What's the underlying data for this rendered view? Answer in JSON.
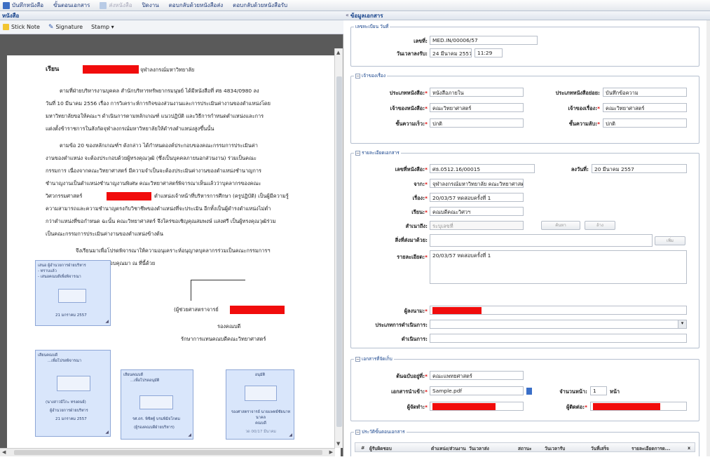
{
  "toolbar": {
    "save_label": "บันทึกหนังสือ",
    "steps_label": "ขั้นตอนเอกสาร",
    "send_label": "ส่งหนังสือ",
    "close_label": "ปิดงาน",
    "reply_send_label": "ตอบกลับด้วยหนังสือส่ง",
    "reply_recv_label": "ตอบกลับด้วยหนังสือรับ"
  },
  "left_panel": {
    "title": "หนังสือ"
  },
  "right_panel": {
    "title": "ข้อมูลเอกสาร"
  },
  "viewer_toolbar": {
    "sticknote_label": "Stick Note",
    "signature_label": "Signature",
    "stamp_label": "Stamp ▾"
  },
  "document": {
    "salutation": "เรียน",
    "recipient": "จุฬาลงกรณ์มหาวิทยาลัย",
    "p1": [
      "ตามที่ฝ่ายบริหารงานบุคคล สำนักบริหารทรัพยากรมนุษย์ ได้มีหนังสือที่ ศธ 4834/0980 ลง",
      "วันที่ 10 มีนาคม 2556 เรื่อง การวิเคราะห์การกิจของส่วนงานและการประเมินค่างานของตำแหน่งโดย",
      "มหาวิทยาลัยขอให้คณะฯ ดำเนินการตามหลักเกณฑ์ แนวปฏิบัติ และวิธีการกำหนดตำแหน่งและการ",
      "แต่งตั้งข้าราชการในสังกัดจุฬาลงกรณ์มหาวิทยาลัยให้ดำรงตำแหน่งสูงขึ้นนั้น"
    ],
    "p2": [
      "ตามข้อ 20 ของหลักเกณฑ์ฯ ดังกล่าว ได้กำหนดองค์ประกอบของคณะกรรมการประเมินค่า",
      "งานของตำแหน่ง จะต้องประกอบด้วยผู้ทรงคุณวุฒิ (ซึ่งเป็นบุคคลภายนอกส่วนงาน) ร่วมเป็นคณะ",
      "กรรมการ เนื่องจากคณะวิทยาศาสตร์ มีความจำเป็นจะต้องประเมินค่างานของตำแหน่งชำนาญการ",
      "ชำนาญงานเป็นตำแหน่งชำนาญงานพิเศษ คณะวิทยาศาสตร์พิจารณาเห็นแล้วว่าบุคลากรของคณะ",
      "วิศวกรรมศาสตร์",
      "ตำแหน่งเจ้าหน้าที่บริหารการศึกษา (ครูปฏิบัติ) เป็นผู้มีความรู้",
      "ความสามารถและความชำนาญตรงกับวิชาชีพของตำแหน่งที่จะประเมิน อีกทั้งเป็นผู้ดำรงตำแหน่งไม่ต่ำ",
      "กว่าตำแหน่งที่ขอกำหนด ฉะนั้น คณะวิทยาศาสตร์ จึงใคร่ขอเชิญคุณสมพงษ์ แสงศรี เป็นผู้ทรงคุณวุฒิร่วม",
      "เป็นคณะกรรมการประเมินค่างานของตำแหน่งข้างต้น"
    ],
    "p3": [
      "จึงเรียนมาเพื่อโปรดพิจารณาให้ความอนุเคราะห์อนุญาตบุคลากรร่วมเป็นคณะกรรมการฯ",
      "ขอขอบคุณมา ณ ที่นี้ด้วย"
    ],
    "signer_prefix": "(ผู้ช่วยศาสตราจารย์",
    "signer_title1": "รองคณบดี",
    "signer_title2": "รักษาการแทนคณบดีคณะวิทยาศาสตร์"
  },
  "notes": {
    "n1_l1": "เสนอ ผู้อำนวยการฝ่ายบริหาร",
    "n1_l2": "- ทราบแล้ว",
    "n1_l3": "- เสนอคณบดีเพื่อพิจารณา",
    "n1_date": "21 มกราคม 2557",
    "n2_l1": "เสียนคณบดี",
    "n2_l2": "...เพื่อโปรดพิจารณา",
    "n2_name": "(นางสาวมีโกะ ทรงดนย์)",
    "n2_title": "ผู้อำนวยการฝ่ายบริหาร",
    "n2_date": "21 มกราคม 2557",
    "n3_l1": "เสียนคณบดี",
    "n3_l2": "...เพื่อโปรดอนุมัติ",
    "n3_name": "รศ.ดร. พิชิตฐ์ บรมพิมิจโกตม",
    "n3_title": "(ผู้รองคณบดีฝ่ายบริหาร)",
    "n4_l1": "อนุมัติ",
    "n4_name": "รองศาสตราจารย์ นายแพทย์ชัยนาท นาคล",
    "n4_title": "คณบดี",
    "n4_date": "วด 00/17 มีนาคม"
  },
  "fields": {
    "doc_no_label": "เลขที่:",
    "doc_no": "MED.IN/00006/57",
    "datetime_label": "วันเวลาลงรับ:",
    "date": "24 มีนาคม 2557",
    "time": "11:29",
    "booknum_section": "เลขทะเบียน วันที่",
    "owner_section": "เจ้าของเรื่อง",
    "doc_type_label": "ประเภทหนังสือ:",
    "doc_type": "หนังสือภายใน",
    "sub_type_label": "ประเภทหนังสือย่อย:",
    "sub_type": "บันทึกข้อความ",
    "book_owner_label": "เจ้าของหนังสือ:",
    "book_owner": "คณะวิทยาศาสตร์",
    "story_owner_label": "เจ้าของเรื่อง:",
    "story_owner": "คณะวิทยาศาสตร์",
    "speed_label": "ชั้นความเร็ว:",
    "speed": "ปกติ",
    "secret_label": "ชั้นความลับ:",
    "secret": "ปกติ",
    "details_section": "รายละเอียดเอกสาร",
    "ref_no_label": "เลขที่หนังสือ:",
    "ref_no": "ศธ.0512.16/00015",
    "ref_date_label": "ลงวันที่:",
    "ref_date": "20 มีนาคม 2557",
    "from_label": "จาก:",
    "from": "จุฬาลงกรณ์มหาวิทยาลัย คณะวิทยาศาสตร์",
    "subject_label": "เรื่อง:",
    "subject": "20/03/57 ทดสอบครั้งที่ 1",
    "to_label": "เรียน:",
    "to": "คณบดีคณะวิศวฯ",
    "cc_label": "สำเนาถึง:",
    "cc": "ระบุเลขที่",
    "search_btn": "ค้นหา",
    "clear_btn": "ล้าง",
    "attach_label": "สิ่งที่ส่งมาด้วย:",
    "attach_btn": "เพิ่ม",
    "detail_label": "รายละเอียด:",
    "detail": "20/03/57 ทดสอบครั้งที่ 1",
    "signer_label": "ผู้ลงนาม:",
    "action_type_label": "ประเภทการดำเนินการ:",
    "action_label": "ดำเนินการ:",
    "storage_section": "เอกสารที่จัดเก็บ",
    "orig_label": "ต้นฉบับอยู่ที่:",
    "orig": "คณะแพทยศาสตร์",
    "file_label": "เอกสารนำเข้า:",
    "file": "Sample.pdf",
    "pages_label": "จำนวนหน้า:",
    "pages": "1",
    "pages_unit": "หน้า",
    "keeper_label": "ผู้จัดทำ:",
    "contact_label": "ผู้ติดต่อ:",
    "history_section": "ประวัติขั้นตอนเอกสาร"
  },
  "history_table": {
    "headers": [
      "#",
      "ผู้รับผิดชอบ",
      "ตำแหน่ง/ส่วนงาน",
      "วันเวลาส่ง",
      "สถานะ",
      "วันเวลารับ",
      "วันที่เสร็จ",
      "รายละเอียดการด...",
      "x"
    ]
  },
  "colors": {
    "redact": "#f10c0c",
    "accent": "#15428b",
    "note_bg": "#d9e6fb"
  }
}
